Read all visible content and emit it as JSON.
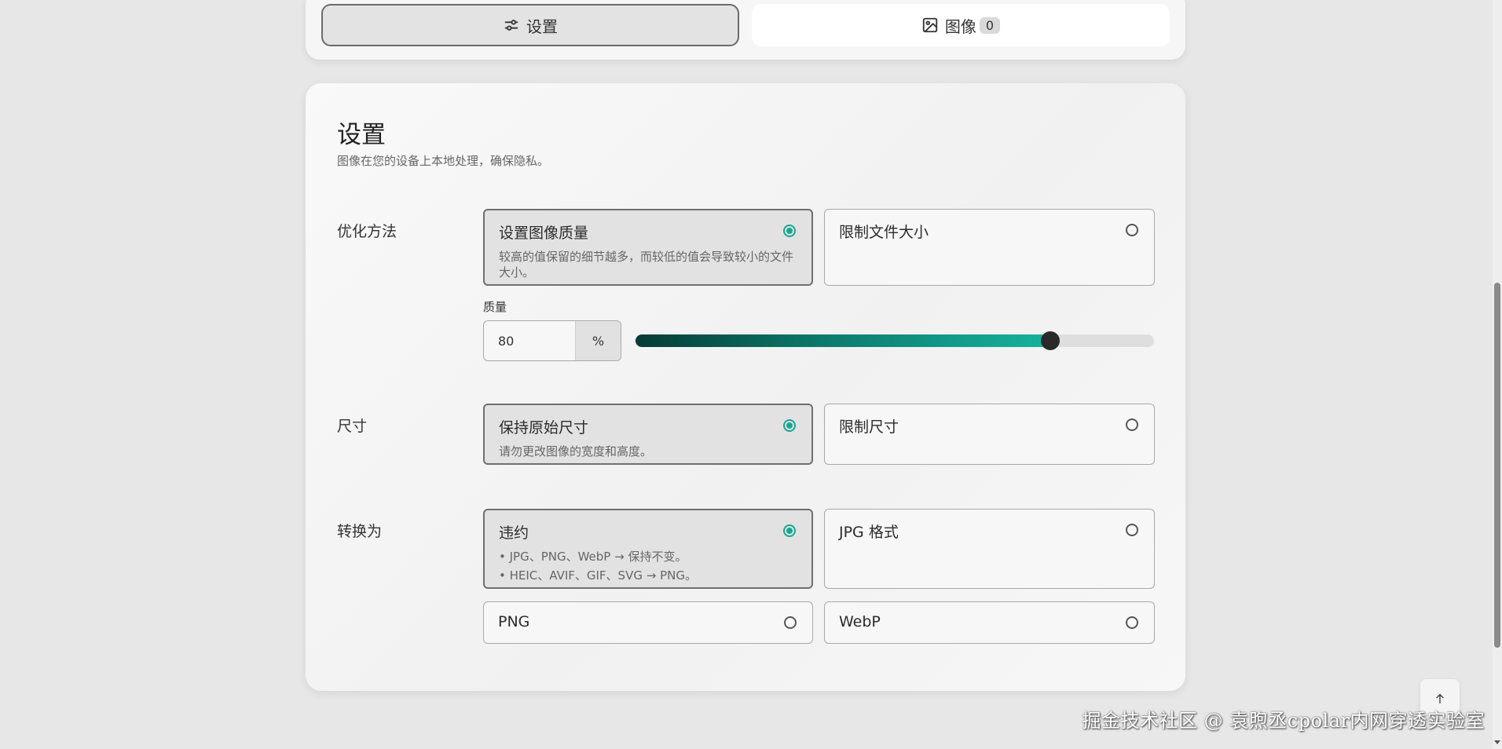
{
  "tabs": [
    {
      "label": "设置",
      "icon": "sliders-icon",
      "active": true
    },
    {
      "label": "图像",
      "icon": "image-icon",
      "badge": "0",
      "active": false
    }
  ],
  "settings": {
    "title": "设置",
    "subtitle": "图像在您的设备上本地处理，确保隐私。"
  },
  "optimization": {
    "label": "优化方法",
    "options": [
      {
        "title": "设置图像质量",
        "desc": "较高的值保留的细节越多，而较低的值会导致较小的文件大小。",
        "selected": true
      },
      {
        "title": "限制文件大小",
        "selected": false
      }
    ],
    "quality_label": "质量",
    "quality_value": "80",
    "quality_unit": "%",
    "quality_percent": 80
  },
  "dimensions": {
    "label": "尺寸",
    "options": [
      {
        "title": "保持原始尺寸",
        "desc": "请勿更改图像的宽度和高度。",
        "selected": true
      },
      {
        "title": "限制尺寸",
        "selected": false
      }
    ]
  },
  "convert": {
    "label": "转换为",
    "options": [
      {
        "title": "违约",
        "desc_lines": [
          "• JPG、PNG、WebP → 保持不变。",
          "• HEIC、AVIF、GIF、SVG → PNG。"
        ],
        "selected": true
      },
      {
        "title": "JPG 格式",
        "selected": false
      },
      {
        "title": "PNG",
        "selected": false
      },
      {
        "title": "WebP",
        "selected": false
      }
    ]
  },
  "scroll_top_icon": "arrow-up-icon",
  "watermark": "掘金技术社区 @ 袁煦丞cpolar内网穿透实验室",
  "colors": {
    "accent": "#16a694",
    "slider_start": "#063b35",
    "slider_end": "#16b39d"
  }
}
